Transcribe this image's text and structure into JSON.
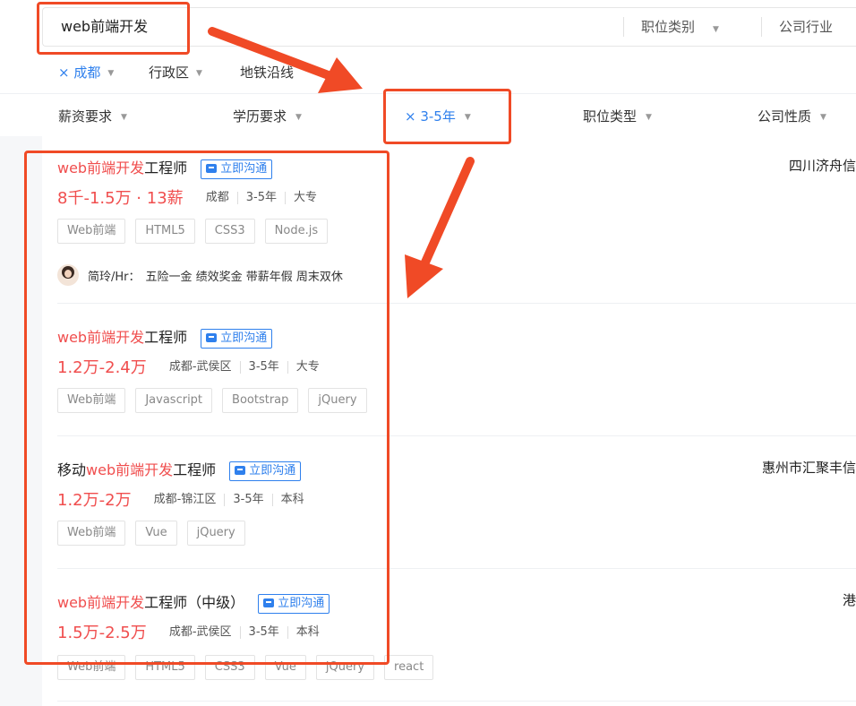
{
  "search": {
    "keyword": "web前端开发",
    "filter_job_category": "职位类别",
    "filter_industry": "公司行业"
  },
  "location": {
    "city": "× 成都",
    "district": "行政区",
    "subway": "地铁沿线"
  },
  "conditions": {
    "salary": "薪资要求",
    "education": "学历要求",
    "experience": "× 3-5年",
    "job_type": "职位类型",
    "company_nature": "公司性质"
  },
  "chat_label": "立即沟通",
  "jobs": [
    {
      "title_prefix": "",
      "title_highlight": "web前端开发",
      "title_suffix": "工程师",
      "company": "四川济舟信",
      "salary": "8千-1.5万 · 13薪",
      "location": "成都",
      "experience": "3-5年",
      "education": "大专",
      "skills": [
        "Web前端",
        "HTML5",
        "CSS3",
        "Node.js"
      ],
      "hr_name": "简玲/Hr：",
      "hr_words": "五险一金 绩效奖金 带薪年假 周末双休"
    },
    {
      "title_prefix": "",
      "title_highlight": "web前端开发",
      "title_suffix": "工程师",
      "company": "",
      "salary": "1.2万-2.4万",
      "location": "成都-武侯区",
      "experience": "3-5年",
      "education": "大专",
      "skills": [
        "Web前端",
        "Javascript",
        "Bootstrap",
        "jQuery"
      ]
    },
    {
      "title_prefix": "移动",
      "title_highlight": "web前端开发",
      "title_suffix": "工程师",
      "company": "惠州市汇聚丰信",
      "salary": "1.2万-2万",
      "location": "成都-锦江区",
      "experience": "3-5年",
      "education": "本科",
      "skills": [
        "Web前端",
        "Vue",
        "jQuery"
      ]
    },
    {
      "title_prefix": "",
      "title_highlight": "web前端开发",
      "title_suffix": "工程师（中级）",
      "company": "港",
      "salary": "1.5万-2.5万",
      "location": "成都-武侯区",
      "experience": "3-5年",
      "education": "本科",
      "skills": [
        "Web前端",
        "HTML5",
        "CSS3",
        "Vue",
        "jQuery",
        "react"
      ]
    }
  ],
  "colors": {
    "highlight_red": "#f04e4e",
    "link_blue": "#2f80ed",
    "annotation_red": "#f04a26"
  }
}
